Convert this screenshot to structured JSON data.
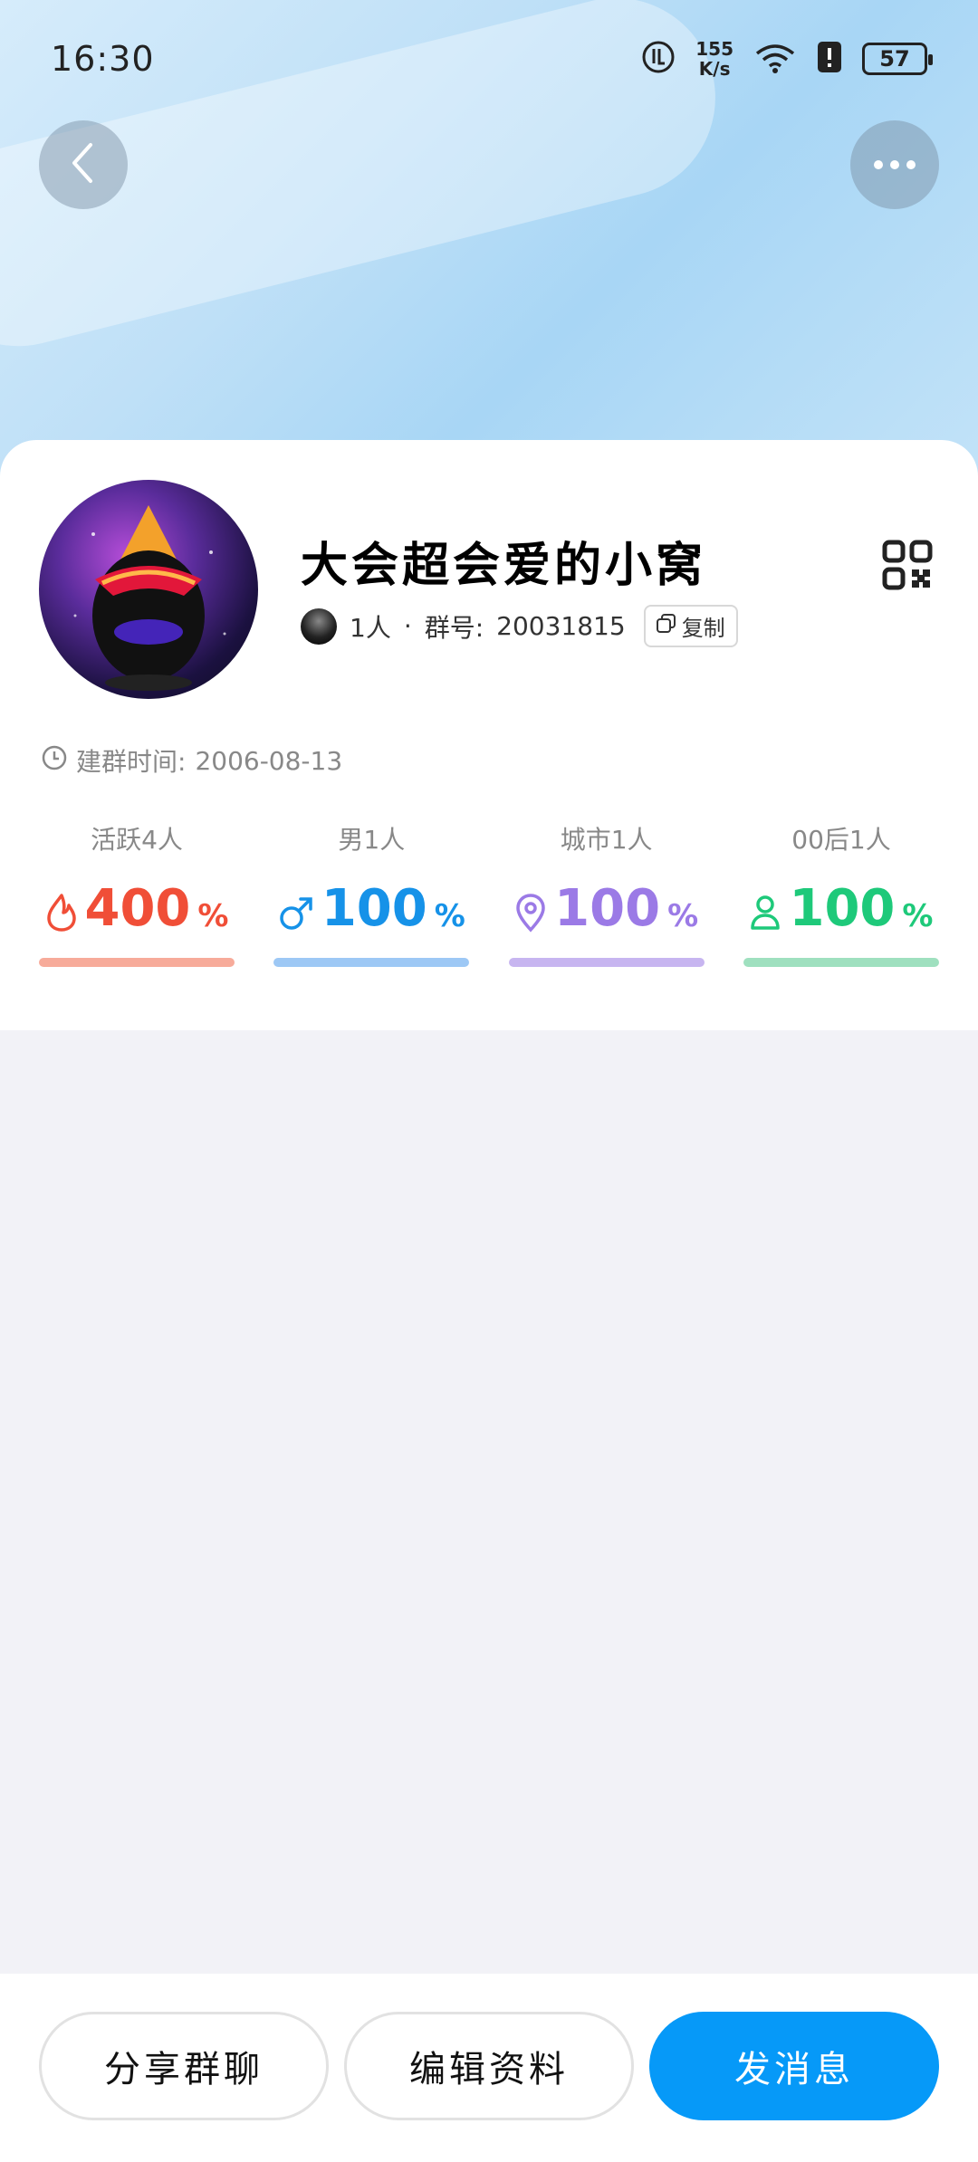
{
  "status_bar": {
    "time": "16:30",
    "net_speed_value": "155",
    "net_speed_unit": "K/s",
    "battery": "57"
  },
  "group": {
    "name": "大会超会爱的小窝",
    "member_count": "1人",
    "separator": "·",
    "id_label": "群号:",
    "id_value": "20031815",
    "copy_label": "复制",
    "created_label": "建群时间:",
    "created_date": "2006-08-13"
  },
  "stats": [
    {
      "label": "活跃4人",
      "value": "400",
      "unit": "%",
      "icon": "flame-icon",
      "color": "#f04e37",
      "bar_color": "#f7ab9a"
    },
    {
      "label": "男1人",
      "value": "100",
      "unit": "%",
      "icon": "male-icon",
      "color": "#1692e8",
      "bar_color": "#9dc8f5"
    },
    {
      "label": "城市1人",
      "value": "100",
      "unit": "%",
      "icon": "location-pin-icon",
      "color": "#9b7ae6",
      "bar_color": "#c7b5f0"
    },
    {
      "label": "00后1人",
      "value": "100",
      "unit": "%",
      "icon": "person-icon",
      "color": "#1ec97a",
      "bar_color": "#9fe0bf"
    }
  ],
  "actions": {
    "share": "分享群聊",
    "edit": "编辑资料",
    "send": "发消息"
  }
}
